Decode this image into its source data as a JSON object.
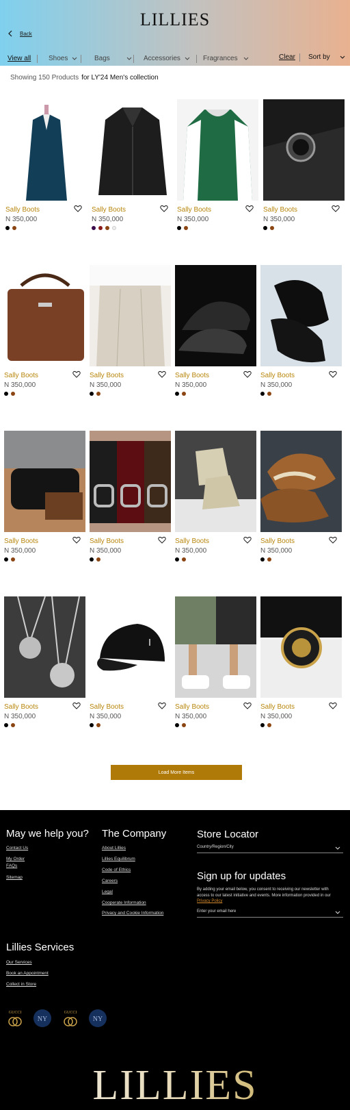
{
  "header": {
    "logo": "LILLIES",
    "back_label": "Back"
  },
  "filters": {
    "view_all": "View all",
    "items": [
      "Shoes",
      "Bags",
      "Accessories",
      "Fragrances"
    ],
    "clear": "Clear",
    "sort": "Sort by"
  },
  "results": {
    "count_text": "Showing 150 Products",
    "collection": "for LY'24 Men's collection"
  },
  "products": [
    {
      "name": "Sally Boots",
      "price": "N 350,000",
      "image": "blue-suit",
      "swatches": [
        "#000000",
        "#8b4513"
      ]
    },
    {
      "name": "Sally Boots",
      "price": "N 350,000",
      "image": "leather-jacket",
      "swatches": [
        "#3a0a4a",
        "#8b1a1a",
        "#8b4513",
        "#eeeeee"
      ]
    },
    {
      "name": "Sally Boots",
      "price": "N 350,000",
      "image": "varsity-jacket",
      "swatches": [
        "#000000",
        "#8b4513"
      ]
    },
    {
      "name": "Sally Boots",
      "price": "N 350,000",
      "image": "wrist-watch",
      "swatches": [
        "#000000",
        "#8b4513"
      ]
    },
    {
      "name": "Sally Boots",
      "price": "N 350,000",
      "image": "leather-bag",
      "swatches": [
        "#000000",
        "#8b4513"
      ]
    },
    {
      "name": "Sally Boots",
      "price": "N 350,000",
      "image": "pleated-trousers",
      "swatches": [
        "#000000",
        "#8b4513"
      ]
    },
    {
      "name": "Sally Boots",
      "price": "N 350,000",
      "image": "oxford-shoes",
      "swatches": [
        "#000000",
        "#8b4513"
      ]
    },
    {
      "name": "Sally Boots",
      "price": "N 350,000",
      "image": "tassel-loafer",
      "swatches": [
        "#000000",
        "#8b4513"
      ]
    },
    {
      "name": "Sally Boots",
      "price": "N 350,000",
      "image": "toiletry-bag",
      "swatches": [
        "#000000",
        "#8b4513"
      ]
    },
    {
      "name": "Sally Boots",
      "price": "N 350,000",
      "image": "leather-belts",
      "swatches": [
        "#000000",
        "#8b4513"
      ]
    },
    {
      "name": "Sally Boots",
      "price": "N 350,000",
      "image": "beige-boots",
      "swatches": [
        "#000000",
        "#8b4513"
      ]
    },
    {
      "name": "Sally Boots",
      "price": "N 350,000",
      "image": "suede-slippers",
      "swatches": [
        "#000000",
        "#8b4513"
      ]
    },
    {
      "name": "Sally Boots",
      "price": "N 350,000",
      "image": "pendant-necklaces",
      "swatches": [
        "#000000",
        "#8b4513"
      ]
    },
    {
      "name": "Sally Boots",
      "price": "N 350,000",
      "image": "black-cap",
      "swatches": [
        "#000000",
        "#8b4513"
      ]
    },
    {
      "name": "Sally Boots",
      "price": "N 350,000",
      "image": "cargo-shorts",
      "swatches": [
        "#000000",
        "#8b4513"
      ]
    },
    {
      "name": "Sally Boots",
      "price": "N 350,000",
      "image": "skeleton-watch",
      "swatches": [
        "#000000",
        "#8b4513"
      ]
    }
  ],
  "load_more": "Load More Items",
  "footer": {
    "help_title": "May we help you?",
    "help_links": [
      "Contact Us",
      "My Order",
      "FAQs",
      "Sitemap"
    ],
    "company_title": "The Company",
    "company_links": [
      "About Lillies",
      "Lillies Equilibrum",
      "Code of Ethics",
      "Careers",
      "Legal",
      "Cooperate Information",
      "Privacy and Cookie Information"
    ],
    "store_title": "Store Locator",
    "store_select": "Country/Region/City",
    "signup_title": "Sign up for updates",
    "signup_text": "By adding your email below, you consent to receiving our newsletter with access to our latest initiative and events. More information provided in our",
    "privacy_link": "Privacy Policy",
    "email_placeholder": "Enter your email here",
    "services_title": "Lillies Services",
    "services_links": [
      "Our Services",
      "Book an Appointment",
      "Collect in Store"
    ],
    "brand_badges": [
      "GUCCI",
      "NY",
      "GUCCI",
      "NY"
    ],
    "big_logo": "LILLIES"
  },
  "colors": {
    "accent": "#b07a08",
    "price_name": "#b8860b",
    "footer_bg": "#000000"
  }
}
